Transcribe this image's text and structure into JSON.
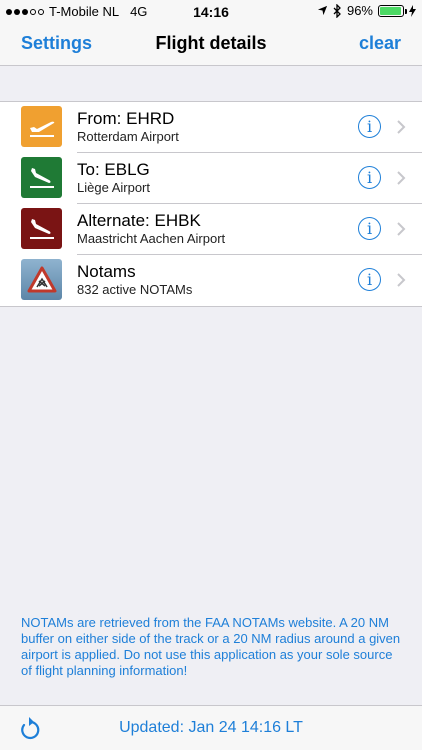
{
  "status_bar": {
    "carrier": "T-Mobile NL",
    "network": "4G",
    "time": "14:16",
    "battery": "96%"
  },
  "nav": {
    "left_button": "Settings",
    "title": "Flight details",
    "right_button": "clear"
  },
  "rows": [
    {
      "title": "From: EHRD",
      "subtitle": "Rotterdam Airport",
      "icon": "takeoff-icon",
      "color": "#f0a030"
    },
    {
      "title": "To: EBLG",
      "subtitle": "Liège Airport",
      "icon": "landing-icon",
      "color": "#1f7a35"
    },
    {
      "title": "Alternate: EHBK",
      "subtitle": "Maastricht Aachen Airport",
      "icon": "landing-icon",
      "color": "#7a1414"
    },
    {
      "title": "Notams",
      "subtitle": "832 active NOTAMs",
      "icon": "warning-sign-icon",
      "color": "#c0392b"
    }
  ],
  "footnote": "NOTAMs are retrieved from the FAA NOTAMs website. A 20 NM buffer on either side of the track or a 20 NM radius around a given airport is applied. Do not use this application as your sole source of flight planning information!",
  "toolbar": {
    "updated": "Updated: Jan 24 14:16 LT"
  },
  "colors": {
    "accent": "#1e7fd8",
    "background": "#efeff4"
  }
}
